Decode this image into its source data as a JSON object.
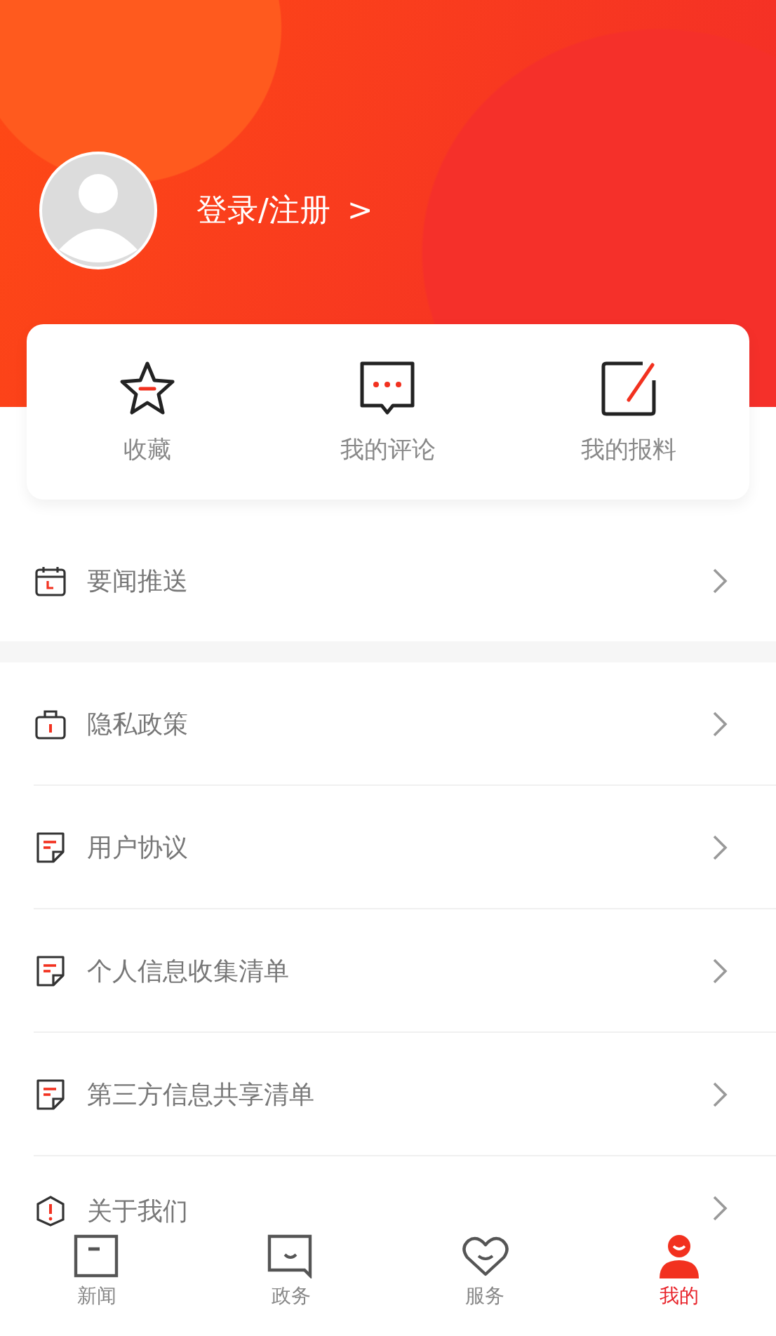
{
  "profile": {
    "login_label": "登录/注册",
    "chevron": ">"
  },
  "shortcuts": [
    {
      "kind": "star",
      "label": "收藏"
    },
    {
      "kind": "comment",
      "label": "我的评论"
    },
    {
      "kind": "edit",
      "label": "我的报料"
    }
  ],
  "sections": [
    [
      {
        "kind": "calendar",
        "label": "要闻推送"
      }
    ],
    [
      {
        "kind": "lock",
        "label": "隐私政策"
      },
      {
        "kind": "doc",
        "label": "用户协议"
      },
      {
        "kind": "doc",
        "label": "个人信息收集清单"
      },
      {
        "kind": "doc",
        "label": "第三方信息共享清单"
      },
      {
        "kind": "alert",
        "label": "关于我们"
      }
    ]
  ],
  "tabs": [
    {
      "kind": "news",
      "label": "新闻",
      "selected": false
    },
    {
      "kind": "gov",
      "label": "政务",
      "selected": false
    },
    {
      "kind": "service",
      "label": "服务",
      "selected": false
    },
    {
      "kind": "me",
      "label": "我的",
      "selected": true
    }
  ]
}
